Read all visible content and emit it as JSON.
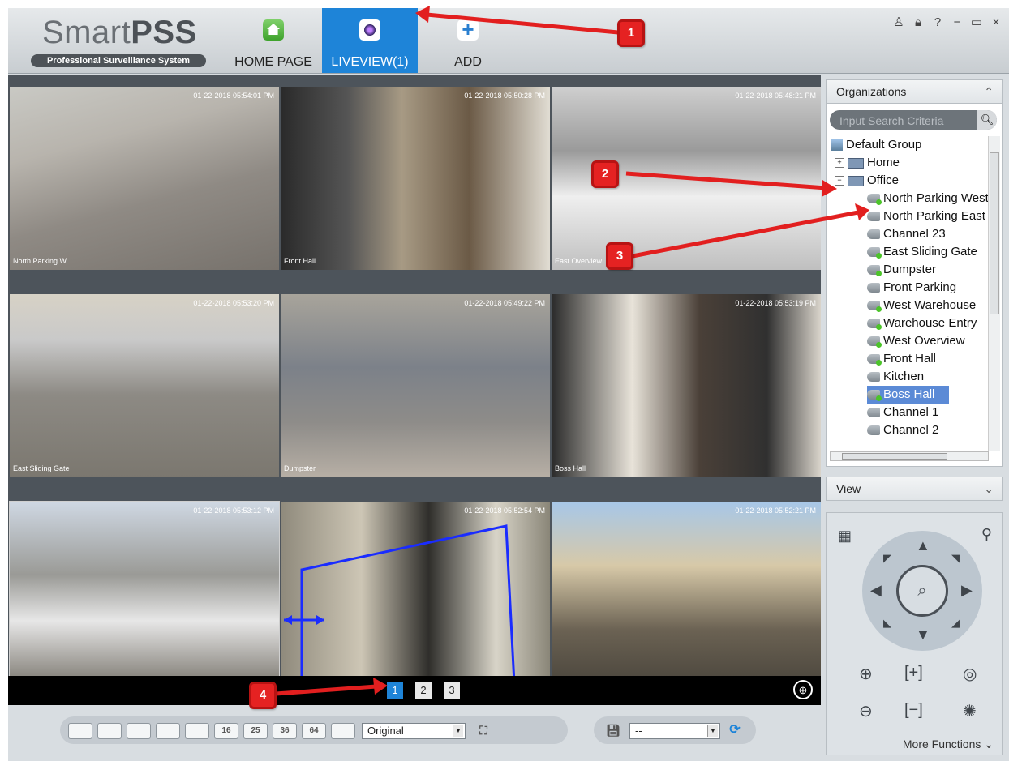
{
  "header": {
    "logo_title_light": "Smart",
    "logo_title_bold": "PSS",
    "logo_subtitle": "Professional Surveillance System",
    "tabs": [
      {
        "label": "HOME PAGE",
        "icon": "home-icon"
      },
      {
        "label": "LIVEVIEW(1)",
        "icon": "camera-icon",
        "active": true
      },
      {
        "label": "ADD",
        "icon": "plus-icon"
      }
    ],
    "window_controls": [
      "user-icon",
      "lock-icon",
      "help-icon",
      "minimize-icon",
      "maximize-icon",
      "close-icon"
    ],
    "window_glyphs": [
      "♙",
      "🔒︎",
      "?",
      "−",
      "▭",
      "×"
    ]
  },
  "live_view": {
    "cells": [
      {
        "camera": "North Parking W",
        "timestamp": "01-22-2018 05:54:01 PM"
      },
      {
        "camera": "Front Hall",
        "timestamp": "01-22-2018 05:50:28 PM"
      },
      {
        "camera": "East Overview",
        "timestamp": "01-22-2018 05:48:21 PM"
      },
      {
        "camera": "East Sliding Gate",
        "timestamp": "01-22-2018 05:53:20 PM"
      },
      {
        "camera": "Dumpster",
        "timestamp": "01-22-2018 05:49:22 PM"
      },
      {
        "camera": "Boss Hall",
        "timestamp": "01-22-2018 05:53:19 PM"
      },
      {
        "camera": "",
        "timestamp": "01-22-2018 05:53:12 PM"
      },
      {
        "camera": "",
        "timestamp": "01-22-2018 05:52:54 PM"
      },
      {
        "camera": "",
        "timestamp": "01-22-2018 05:52:21 PM"
      }
    ],
    "pages": [
      "1",
      "2",
      "3"
    ],
    "active_page": "1"
  },
  "toolbar": {
    "layouts": [
      "1",
      "4",
      "6",
      "8",
      "9",
      "16",
      "25",
      "36",
      "64",
      "custom"
    ],
    "layout_labels": [
      "",
      "",
      "",
      "",
      "",
      "16",
      "25",
      "36",
      "64",
      ""
    ],
    "stream_mode": "Original",
    "view_select": "--"
  },
  "panel": {
    "organizations_title": "Organizations",
    "search_placeholder": "Input Search Criteria",
    "tree": [
      {
        "label": "Default Group",
        "type": "group",
        "level": 0
      },
      {
        "label": "Home",
        "type": "device",
        "level": 1,
        "expand": "+"
      },
      {
        "label": "Office",
        "type": "device",
        "level": 1,
        "expand": "−"
      },
      {
        "label": "North Parking West",
        "type": "camera",
        "online": true,
        "level": 2
      },
      {
        "label": "North Parking East",
        "type": "camera",
        "online": false,
        "level": 2
      },
      {
        "label": "Channel 23",
        "type": "camera",
        "online": false,
        "level": 2
      },
      {
        "label": "East Sliding Gate",
        "type": "camera",
        "online": true,
        "level": 2
      },
      {
        "label": "Dumpster",
        "type": "camera",
        "online": true,
        "level": 2
      },
      {
        "label": "Front Parking",
        "type": "camera",
        "online": false,
        "level": 2
      },
      {
        "label": "West Warehouse",
        "type": "camera",
        "online": true,
        "level": 2
      },
      {
        "label": "Warehouse Entry",
        "type": "camera",
        "online": true,
        "level": 2
      },
      {
        "label": "West Overview",
        "type": "camera",
        "online": true,
        "level": 2
      },
      {
        "label": "Front Hall",
        "type": "camera",
        "online": true,
        "level": 2
      },
      {
        "label": "Kitchen",
        "type": "camera",
        "online": false,
        "level": 2
      },
      {
        "label": "Boss Hall",
        "type": "camera",
        "online": true,
        "level": 2,
        "selected": true
      },
      {
        "label": "Channel 1",
        "type": "camera",
        "online": false,
        "level": 2
      },
      {
        "label": "Channel 2",
        "type": "camera",
        "online": false,
        "level": 2
      }
    ],
    "view_title": "View",
    "more_functions": "More Functions"
  },
  "annotations": [
    "1",
    "2",
    "3",
    "4"
  ]
}
